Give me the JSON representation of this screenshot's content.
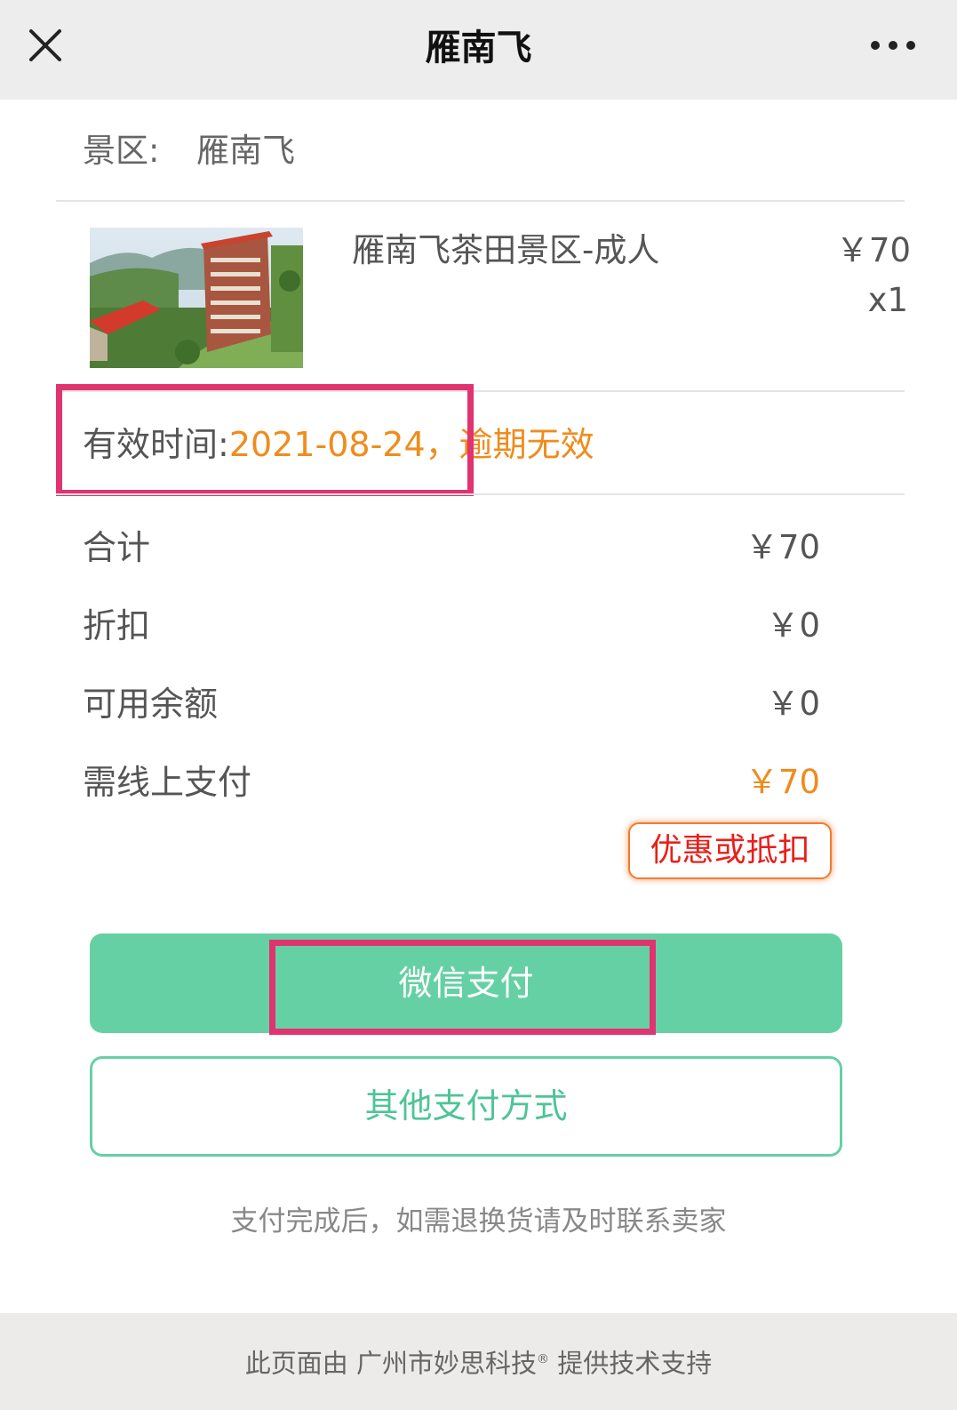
{
  "header": {
    "title": "雁南飞"
  },
  "scenic": {
    "label": "景区:",
    "name": "雁南飞"
  },
  "product": {
    "name": "雁南飞茶田景区-成人",
    "price": "￥70",
    "quantity": "x1"
  },
  "validity": {
    "label": "有效时间:",
    "date": "2021-08-24，",
    "note": "逾期无效"
  },
  "summary": {
    "rows": [
      {
        "label": "合计",
        "value": "￥70"
      },
      {
        "label": "折扣",
        "value": "￥0"
      },
      {
        "label": "可用余额",
        "value": "￥0"
      },
      {
        "label": "需线上支付",
        "value": "￥70"
      }
    ]
  },
  "buttons": {
    "coupon": "优惠或抵扣",
    "wechat_pay": "微信支付",
    "other_pay": "其他支付方式"
  },
  "notice": "支付完成后，如需退换货请及时联系卖家",
  "footer": {
    "prefix": "此页面由 广州市妙思科技",
    "registered": "®",
    "suffix": " 提供技术支持"
  },
  "colors": {
    "accent_green": "#66d0a5",
    "accent_orange": "#ef8c1c",
    "coupon_red": "#e8201a",
    "highlight_pink": "#e0336f"
  }
}
